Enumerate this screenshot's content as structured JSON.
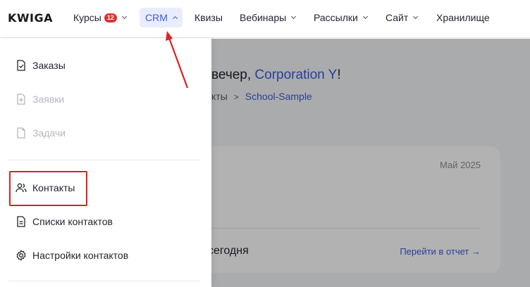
{
  "logo": "KWIGA",
  "nav": {
    "courses": "Курсы",
    "courses_badge": "12",
    "crm": "CRM",
    "quizzes": "Квизы",
    "webinars": "Вебинары",
    "mailings": "Рассылки",
    "site": "Сайт",
    "storage": "Хранилище"
  },
  "menu": {
    "orders": "Заказы",
    "requests": "Заявки",
    "tasks": "Задачи",
    "contacts": "Контакты",
    "contact_lists": "Списки контактов",
    "contact_settings": "Настройки контактов"
  },
  "background": {
    "greeting_prefix": "вечер, ",
    "greeting_name": "Corporation Y",
    "greeting_suffix": "!",
    "crumb_1": "кты",
    "crumb_sep": ">",
    "crumb_2": "School-Sample",
    "card_date": "Май 2025",
    "card_today": "сегодня",
    "card_report": "Перейти в отчет →"
  },
  "colors": {
    "accent": "#3b5bdb",
    "badge": "#e03131",
    "annotation": "#e02020"
  }
}
